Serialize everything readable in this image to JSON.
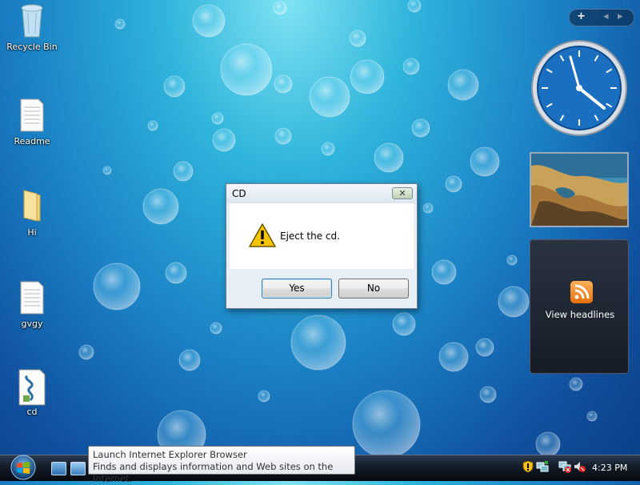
{
  "desktop": {
    "icons": [
      {
        "label": "Recycle Bin"
      },
      {
        "label": "Readme"
      },
      {
        "label": "Hi"
      },
      {
        "label": "gvgy"
      },
      {
        "label": "cd"
      }
    ]
  },
  "dialog": {
    "title": "CD",
    "message": "Eject the cd.",
    "yes_label": "Yes",
    "no_label": "No",
    "close_symbol": "✕"
  },
  "sidebar": {
    "add_gadget_symbol": "+",
    "prev_symbol": "◂",
    "next_symbol": "▸",
    "feed_label": "View headlines"
  },
  "tooltip": {
    "title": "Launch Internet Explorer Browser",
    "description": "Finds and displays information and Web sites on the Internet."
  },
  "taskbar": {
    "clock": "4:23 PM"
  },
  "colors": {
    "desktop_top": "#7fe3f2",
    "desktop_bottom": "#0b3f85",
    "taskbar": "#121b28",
    "clock_face": "#1a6fc0",
    "rss_orange": "#f08a1c",
    "warning_yellow": "#f5c400"
  },
  "icons": [
    "recycle-bin-icon",
    "document-icon",
    "folder-icon",
    "script-icon",
    "warning-icon",
    "close-icon",
    "rss-icon",
    "windows-start-icon",
    "shield-icon",
    "network-icon",
    "volume-muted-icon"
  ]
}
